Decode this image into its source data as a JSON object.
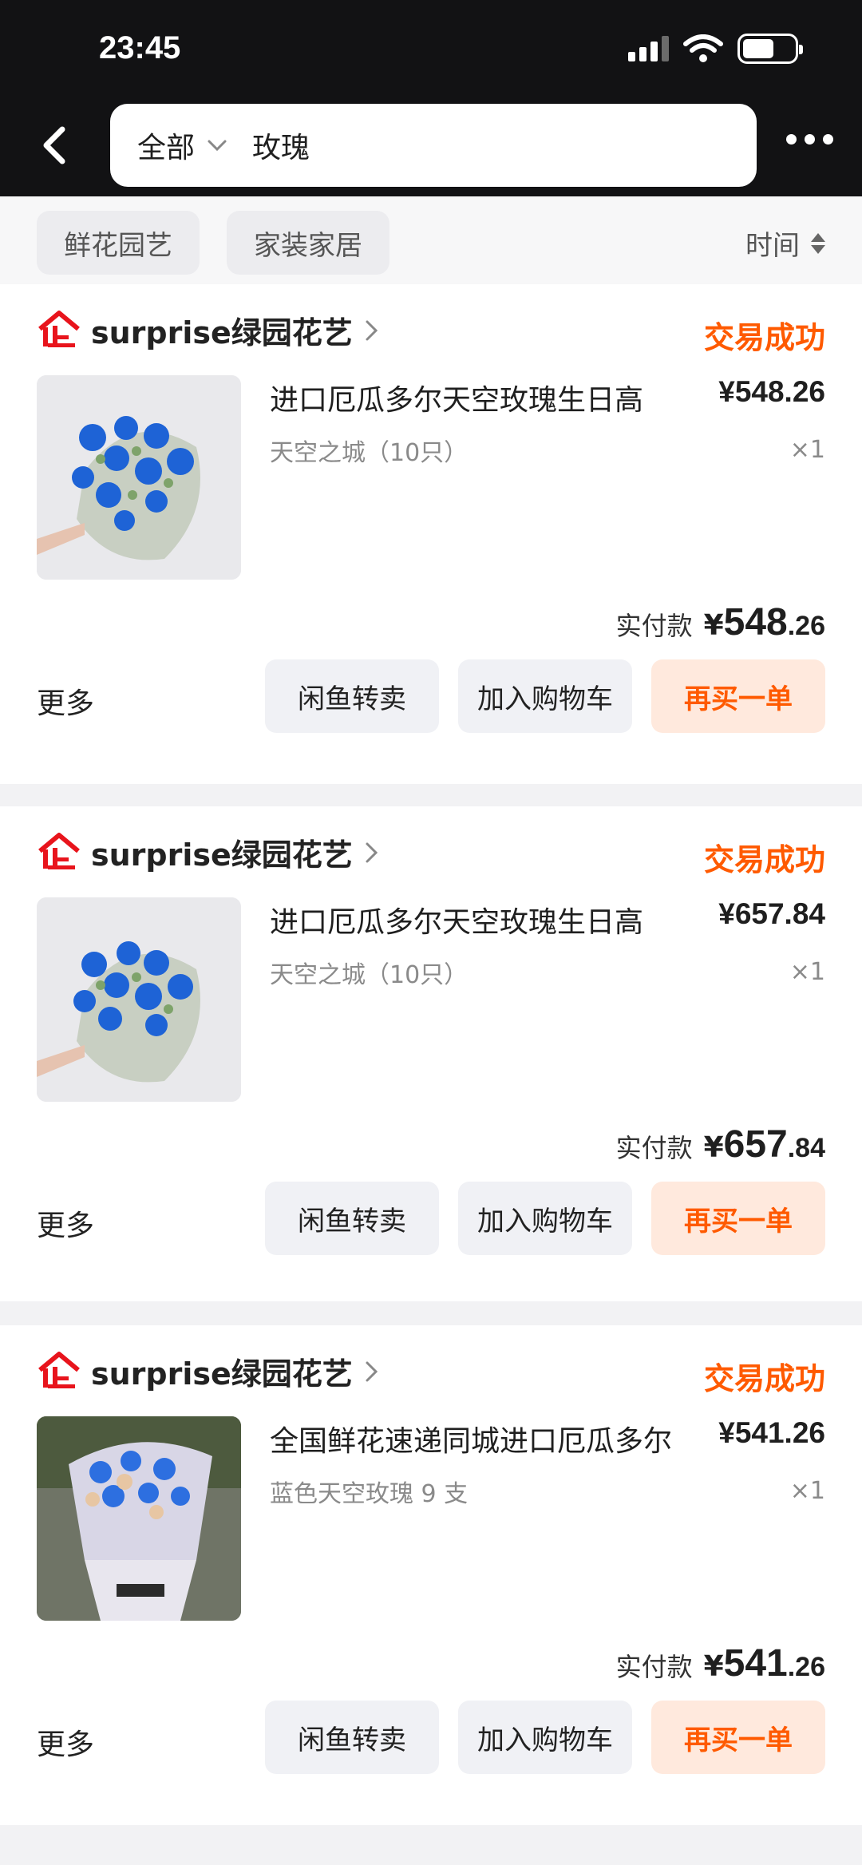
{
  "status_bar": {
    "time": "23:45"
  },
  "header": {
    "search_category": "全部",
    "search_query": "玫瑰"
  },
  "filters": {
    "chips": [
      "鲜花园艺",
      "家装家居"
    ],
    "sort_label": "时间"
  },
  "orders": [
    {
      "shop_name": "surprise绿园花艺",
      "status": "交易成功",
      "title": "进口厄瓜多尔天空玫瑰生日高",
      "sku": "天空之城（10只）",
      "price": "¥548.26",
      "qty": "×1",
      "paid_label": "实付款",
      "paid_currency": "¥",
      "paid_integer": "548",
      "paid_decimal": ".26",
      "more_label": "更多",
      "resell_label": "闲鱼转卖",
      "cart_label": "加入购物车",
      "rebuy_label": "再买一单"
    },
    {
      "shop_name": "surprise绿园花艺",
      "status": "交易成功",
      "title": "进口厄瓜多尔天空玫瑰生日高",
      "sku": "天空之城（10只）",
      "price": "¥657.84",
      "qty": "×1",
      "paid_label": "实付款",
      "paid_currency": "¥",
      "paid_integer": "657",
      "paid_decimal": ".84",
      "more_label": "更多",
      "resell_label": "闲鱼转卖",
      "cart_label": "加入购物车",
      "rebuy_label": "再买一单"
    },
    {
      "shop_name": "surprise绿园花艺",
      "status": "交易成功",
      "title": "全国鲜花速递同城进口厄瓜多尔",
      "sku": "蓝色天空玫瑰 9 支",
      "price": "¥541.26",
      "qty": "×1",
      "paid_label": "实付款",
      "paid_currency": "¥",
      "paid_integer": "541",
      "paid_decimal": ".26",
      "more_label": "更多",
      "resell_label": "闲鱼转卖",
      "cart_label": "加入购物车",
      "rebuy_label": "再买一单"
    }
  ],
  "colors": {
    "accent": "#ff5a00",
    "accent_bg": "#ffe9dd",
    "header_bg": "#121214"
  },
  "icons": {
    "back": "chevron-left-icon",
    "dropdown": "chevron-down-icon",
    "more": "more-dots-icon",
    "shop_logo": "tmall-store-logo-icon",
    "shop_arrow": "chevron-right-icon",
    "sort": "sort-arrows-icon"
  }
}
